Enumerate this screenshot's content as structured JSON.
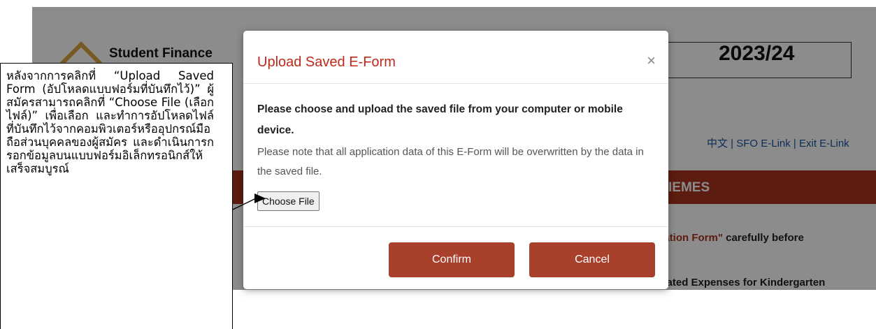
{
  "background": {
    "title": "Student Finance",
    "year": "2023/24",
    "lang_links": "中文 | SFO E-Link | Exit E-Link",
    "banner": "IEMES",
    "line1_red": "cation Form\"",
    "line1_rest": " carefully before",
    "line2": "elated Expenses for Kindergarten"
  },
  "modal": {
    "title": "Upload Saved E-Form",
    "close_label": "×",
    "instruction": "Please choose and upload the saved file from your computer or mobile device.",
    "note": "Please note that all application data of this E-Form will be overwritten by the data in the saved file.",
    "choose_file_label": "Choose File",
    "confirm_label": "Confirm",
    "cancel_label": "Cancel"
  },
  "annotation": {
    "text": "หลังจากการคลิกที่ “Upload Saved Form (อัปโหลดแบบฟอร์มที่บันทึกไว้)” ผู้สมัครสามารถคลิกที่ “Choose File (เลือกไฟล์)” เพื่อเลือก และทำการอัปโหลดไฟล์ที่บันทึกไว้จากคอมพิวเตอร์หรืออุปกรณ์มือถือส่วนบุคคลของผู้สมัคร และดำเนินการกรอกข้อมูลบนแบบฟอร์มอิเล็กทรอนิกส์ให้เสร็จสมบูรณ์"
  },
  "colors": {
    "accent": "#a8402b",
    "title_red": "#c0281c"
  }
}
